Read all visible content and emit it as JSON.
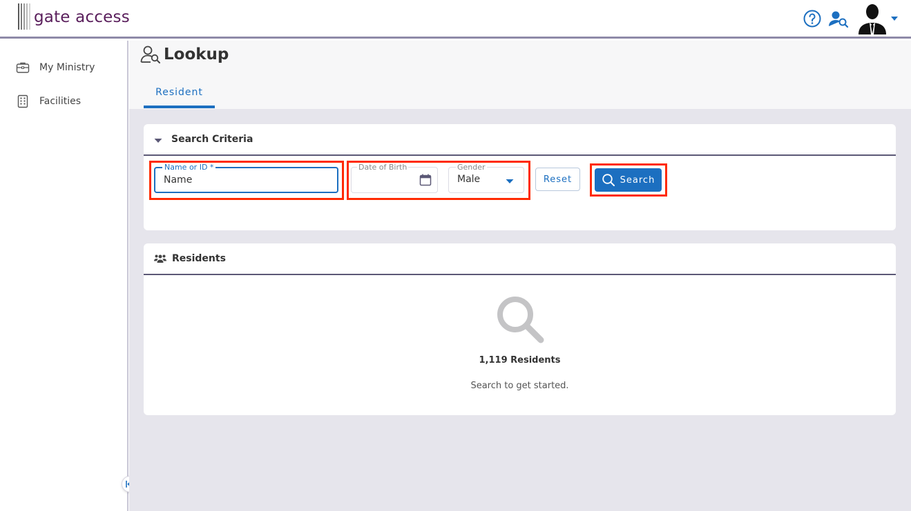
{
  "header": {
    "logo_text": "gate access",
    "colors": {
      "brand": "#5a1f5c",
      "accent": "#1c6fc0",
      "highlight": "#ff2a00"
    }
  },
  "sidebar": {
    "items": [
      {
        "label": "My Ministry",
        "icon": "briefcase-icon"
      },
      {
        "label": "Facilities",
        "icon": "building-icon"
      }
    ]
  },
  "page": {
    "title": "Lookup",
    "tabs": [
      {
        "label": "Resident",
        "active": true
      }
    ]
  },
  "search_criteria": {
    "title": "Search Criteria",
    "name_field": {
      "label": "Name or ID *",
      "value": "Name"
    },
    "dob_field": {
      "label": "Date of Birth",
      "value": ""
    },
    "gender_field": {
      "label": "Gender",
      "value": "Male"
    },
    "reset_label": "Reset",
    "search_label": "Search"
  },
  "residents": {
    "title": "Residents",
    "count_label": "1,119 Residents",
    "hint": "Search to get started."
  }
}
